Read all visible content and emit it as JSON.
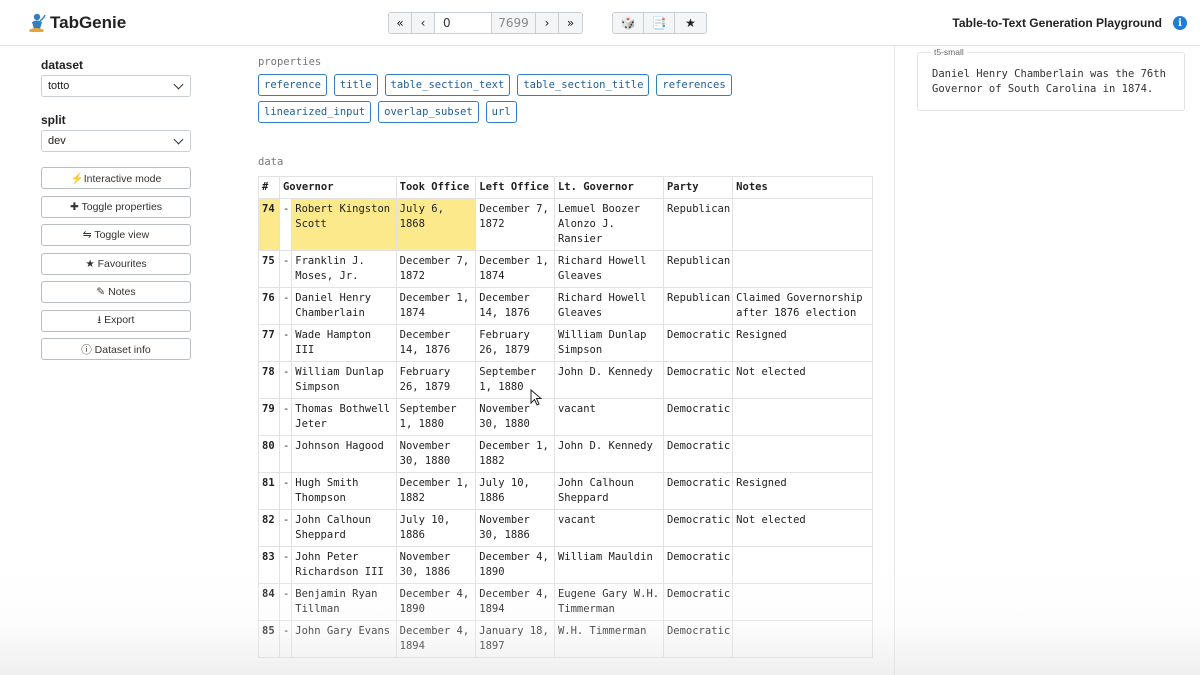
{
  "app": {
    "brand": "TabGenie",
    "title": "Table-to-Text Generation Playground"
  },
  "nav": {
    "first": "«",
    "prev": "‹",
    "index_value": "0",
    "total": "7699",
    "next": "›",
    "last": "»"
  },
  "tools": {
    "random": "🎲",
    "notes": "📑",
    "favourite": "★"
  },
  "sidebar": {
    "dataset_label": "dataset",
    "dataset_value": "totto",
    "split_label": "split",
    "split_value": "dev",
    "buttons": [
      {
        "label": "⚡Interactive mode",
        "name": "interactive-mode-button"
      },
      {
        "label": "✚ Toggle properties",
        "name": "toggle-properties-button"
      },
      {
        "label": "⇋ Toggle view",
        "name": "toggle-view-button"
      },
      {
        "label": "★ Favourites",
        "name": "favourites-button"
      },
      {
        "label": "✎ Notes",
        "name": "notes-button"
      },
      {
        "label": "⭳ Export",
        "name": "export-button"
      },
      {
        "label": "ⓘ Dataset info",
        "name": "dataset-info-button"
      }
    ]
  },
  "properties": {
    "label": "properties",
    "items": [
      "reference",
      "title",
      "table_section_text",
      "table_section_title",
      "references",
      "linearized_input",
      "overlap_subset",
      "url"
    ]
  },
  "table": {
    "label": "data",
    "headers": [
      "#",
      "Governor",
      "Took Office",
      "Left Office",
      "Lt. Governor",
      "Party",
      "Notes"
    ],
    "rows": [
      {
        "num": "74",
        "sep": "-",
        "governor": "Robert Kingston Scott",
        "took": "July 6, 1868",
        "left": "December 7, 1872",
        "lt": "Lemuel Boozer Alonzo J. Ransier",
        "party": "Republican",
        "notes": "",
        "highlight": true
      },
      {
        "num": "75",
        "sep": "-",
        "governor": "Franklin J. Moses, Jr.",
        "took": "December 7, 1872",
        "left": "December 1, 1874",
        "lt": "Richard Howell Gleaves",
        "party": "Republican",
        "notes": "",
        "highlight": false
      },
      {
        "num": "76",
        "sep": "-",
        "governor": "Daniel Henry Chamberlain",
        "took": "December 1, 1874",
        "left": "December 14, 1876",
        "lt": "Richard Howell Gleaves",
        "party": "Republican",
        "notes": "Claimed Governorship after 1876 election",
        "highlight": false
      },
      {
        "num": "77",
        "sep": "-",
        "governor": "Wade Hampton III",
        "took": "December 14, 1876",
        "left": "February 26, 1879",
        "lt": "William Dunlap Simpson",
        "party": "Democratic",
        "notes": "Resigned",
        "highlight": false
      },
      {
        "num": "78",
        "sep": "-",
        "governor": "William Dunlap Simpson",
        "took": "February 26, 1879",
        "left": "September 1, 1880",
        "lt": "John D. Kennedy",
        "party": "Democratic",
        "notes": "Not elected",
        "highlight": false
      },
      {
        "num": "79",
        "sep": "-",
        "governor": "Thomas Bothwell Jeter",
        "took": "September 1, 1880",
        "left": "November 30, 1880",
        "lt": "vacant",
        "party": "Democratic",
        "notes": "",
        "highlight": false
      },
      {
        "num": "80",
        "sep": "-",
        "governor": "Johnson Hagood",
        "took": "November 30, 1880",
        "left": "December 1, 1882",
        "lt": "John D. Kennedy",
        "party": "Democratic",
        "notes": "",
        "highlight": false
      },
      {
        "num": "81",
        "sep": "-",
        "governor": "Hugh Smith Thompson",
        "took": "December 1, 1882",
        "left": "July 10, 1886",
        "lt": "John Calhoun Sheppard",
        "party": "Democratic",
        "notes": "Resigned",
        "highlight": false
      },
      {
        "num": "82",
        "sep": "-",
        "governor": "John Calhoun Sheppard",
        "took": "July 10, 1886",
        "left": "November 30, 1886",
        "lt": "vacant",
        "party": "Democratic",
        "notes": "Not elected",
        "highlight": false
      },
      {
        "num": "83",
        "sep": "-",
        "governor": "John Peter Richardson III",
        "took": "November 30, 1886",
        "left": "December 4, 1890",
        "lt": "William Mauldin",
        "party": "Democratic",
        "notes": "",
        "highlight": false
      },
      {
        "num": "84",
        "sep": "-",
        "governor": "Benjamin Ryan Tillman",
        "took": "December 4, 1890",
        "left": "December 4, 1894",
        "lt": "Eugene Gary W.H. Timmerman",
        "party": "Democratic",
        "notes": "",
        "highlight": false
      },
      {
        "num": "85",
        "sep": "-",
        "governor": "John Gary Evans",
        "took": "December 4, 1894",
        "left": "January 18, 1897",
        "lt": "W.H. Timmerman",
        "party": "Democratic",
        "notes": "",
        "highlight": false
      }
    ]
  },
  "output": {
    "model": "t5-small",
    "text": "Daniel Henry Chamberlain was the 76th Governor of South Carolina in 1874."
  },
  "colors": {
    "highlight": "#fbe98c",
    "accent": "#2f7fc1",
    "info": "#1c7ed6"
  }
}
